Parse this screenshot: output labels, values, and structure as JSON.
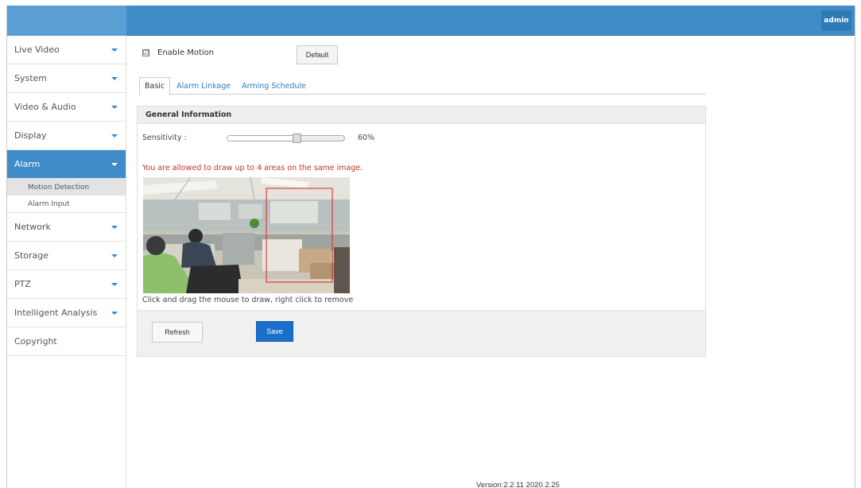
{
  "header": {
    "user_label": "admin"
  },
  "sidebar": {
    "items": [
      {
        "label": "Live Video"
      },
      {
        "label": "System"
      },
      {
        "label": "Video & Audio"
      },
      {
        "label": "Display"
      },
      {
        "label": "Alarm",
        "active": true
      },
      {
        "label": "Network"
      },
      {
        "label": "Storage"
      },
      {
        "label": "PTZ"
      },
      {
        "label": "Intelligent Analysis"
      },
      {
        "label": "Copyright"
      }
    ],
    "alarm_sub": [
      {
        "label": "Motion Detection",
        "active": true
      },
      {
        "label": "Alarm Input"
      }
    ]
  },
  "main": {
    "enable_motion_label": "Enable Motion",
    "enable_motion_checked": true,
    "checkbox_mark": "☑",
    "default_label": "Default",
    "tabs": [
      {
        "label": "Basic",
        "active": true
      },
      {
        "label": "Alarm Linkage"
      },
      {
        "label": "Arming Schedule"
      }
    ],
    "panel_title": "General Information",
    "sensitivity_label": "Sensitivity :",
    "sensitivity_value": "60%",
    "sensitivity_fraction": 0.6,
    "warning": "You are allowed to draw up to 4 areas on the same image.",
    "draw_hint": "Click and drag the mouse to draw, right click to remove",
    "refresh_label": "Refresh",
    "save_label": "Save"
  },
  "footer": {
    "version": "Version:2.2.11  2020.2.25"
  },
  "colors": {
    "accent": "#3f8cc9",
    "save": "#1a6fca",
    "warning": "#c0322b",
    "link": "#2b7ec3"
  }
}
